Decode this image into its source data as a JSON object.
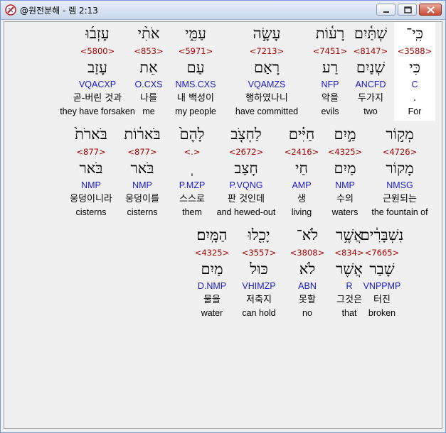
{
  "window": {
    "title": "@원전분해 - 렘 2:13"
  },
  "rows": [
    {
      "words": [
        {
          "heb": "כִּֽי־",
          "strong": "<3588>",
          "lemma": "כִּי",
          "morph": "C",
          "kor": ".",
          "eng": "For"
        },
        {
          "heb": "שְׁתַּ֫יִם",
          "strong": "<8147>",
          "lemma": "שְׁנַיִם",
          "morph": "ANCFD",
          "kor": "두가지",
          "eng": "two"
        },
        {
          "heb": "רָע֫וֹת",
          "strong": "<7451>",
          "lemma": "רַע",
          "morph": "NFP",
          "kor": "악을",
          "eng": "evils"
        },
        {
          "heb": "עָשָׂ֣ה",
          "strong": "<7213>",
          "lemma": "רָאַם",
          "morph": "VQAMZS",
          "kor": "행하였나니",
          "eng": "have committed"
        },
        {
          "heb": "עַמִּ֑י",
          "strong": "<5971>",
          "lemma": "עַם",
          "morph": "NMS.CXS",
          "kor": "내 백성이",
          "eng": "my people"
        },
        {
          "heb": "אֹתִ֨י",
          "strong": "<853>",
          "lemma": "אֵת",
          "morph": "O.CXS",
          "kor": "나를",
          "eng": "me"
        },
        {
          "heb": "עָזְב֜וּ",
          "strong": "<5800>",
          "lemma": "עָזַב",
          "morph": "VQACXP",
          "kor": "곧-버린 것과",
          "eng": "they have forsaken"
        }
      ]
    },
    {
      "words": [
        {
          "heb": "מְק֣וֹר",
          "strong": "<4726>",
          "lemma": "מָקוֹר",
          "morph": "NMSG",
          "kor": "근원되는",
          "eng": "the fountain of"
        },
        {
          "heb": "מַ֣יִם",
          "strong": "<4325>",
          "lemma": "מַיִם",
          "morph": "NMP",
          "kor": "수의",
          "eng": "waters"
        },
        {
          "heb": "חַיִּ֗ים",
          "strong": "<2416>",
          "lemma": "חַי",
          "morph": "AMP",
          "kor": "생",
          "eng": "living"
        },
        {
          "heb": "לַחְצֹ֤ב",
          "strong": "<2672>",
          "lemma": "חָצַב",
          "morph": "P.VQNG",
          "kor": "판 것인데",
          "eng": "and hewed-out"
        },
        {
          "heb": "לָהֶם֙",
          "strong": "<.>",
          "lemma": "ְ",
          "morph": "P.MZP",
          "kor": "스스로",
          "eng": "them"
        },
        {
          "heb": "בֹּאר֔וֹת",
          "strong": "<877>",
          "lemma": "בֹּאר",
          "morph": "NMP",
          "kor": "웅덩이를",
          "eng": "cisterns"
        },
        {
          "heb": "בֹּארֹת֙",
          "strong": "<877>",
          "lemma": "בֹּאר",
          "morph": "NMP",
          "kor": "웅덩이니라",
          "eng": "cisterns"
        }
      ]
    },
    {
      "words": [
        {
          "heb": "נִשְׁבָּרִ֔ים",
          "strong": "<7665>",
          "lemma": "שָׁבַר",
          "morph": "VNPPMP",
          "kor": "터진",
          "eng": "broken"
        },
        {
          "heb": "אֲשֶׁ֥ר",
          "strong": "<834>",
          "lemma": "אֲשֶׁר",
          "morph": "R",
          "kor": "그것은",
          "eng": "that"
        },
        {
          "heb": "לֹא־",
          "strong": "<3808>",
          "lemma": "לֹא",
          "morph": "ABN",
          "kor": "못할",
          "eng": "no"
        },
        {
          "heb": "יָכִ֖לוּ",
          "strong": "<3557>",
          "lemma": "כּוּל",
          "morph": "VHIMZP",
          "kor": "저축지",
          "eng": "can hold"
        },
        {
          "heb": "הַמָּֽיִם׃",
          "strong": "<4325>",
          "lemma": "מַיִם",
          "morph": "D.NMP",
          "kor": "물을",
          "eng": "water"
        }
      ]
    }
  ]
}
